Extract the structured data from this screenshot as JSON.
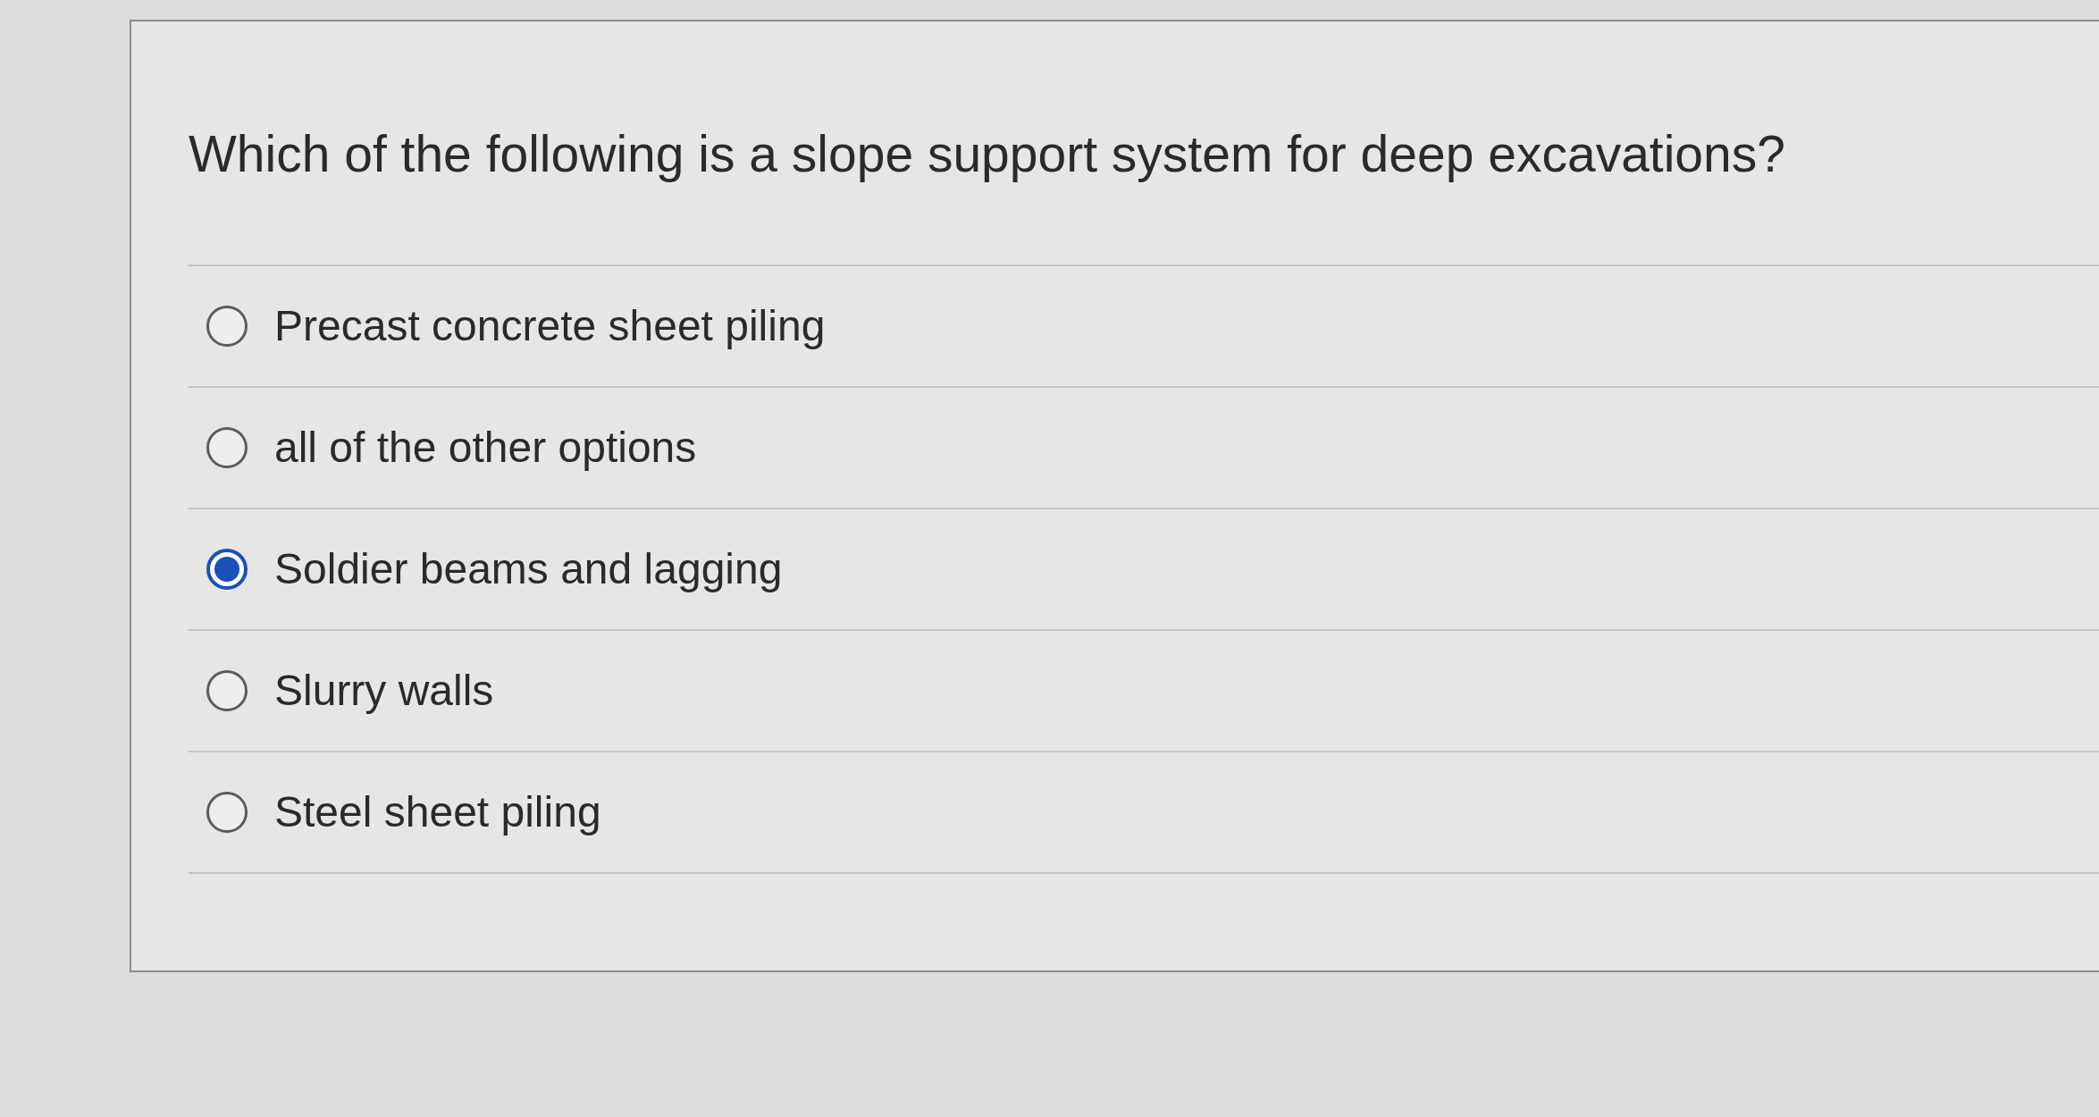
{
  "question": "Which of the following is a slope support system for deep excavations?",
  "options": [
    {
      "label": "Precast concrete sheet piling",
      "selected": false
    },
    {
      "label": "all of the other options",
      "selected": false
    },
    {
      "label": "Soldier beams and lagging",
      "selected": true
    },
    {
      "label": "Slurry walls",
      "selected": false
    },
    {
      "label": "Steel sheet piling",
      "selected": false
    }
  ]
}
